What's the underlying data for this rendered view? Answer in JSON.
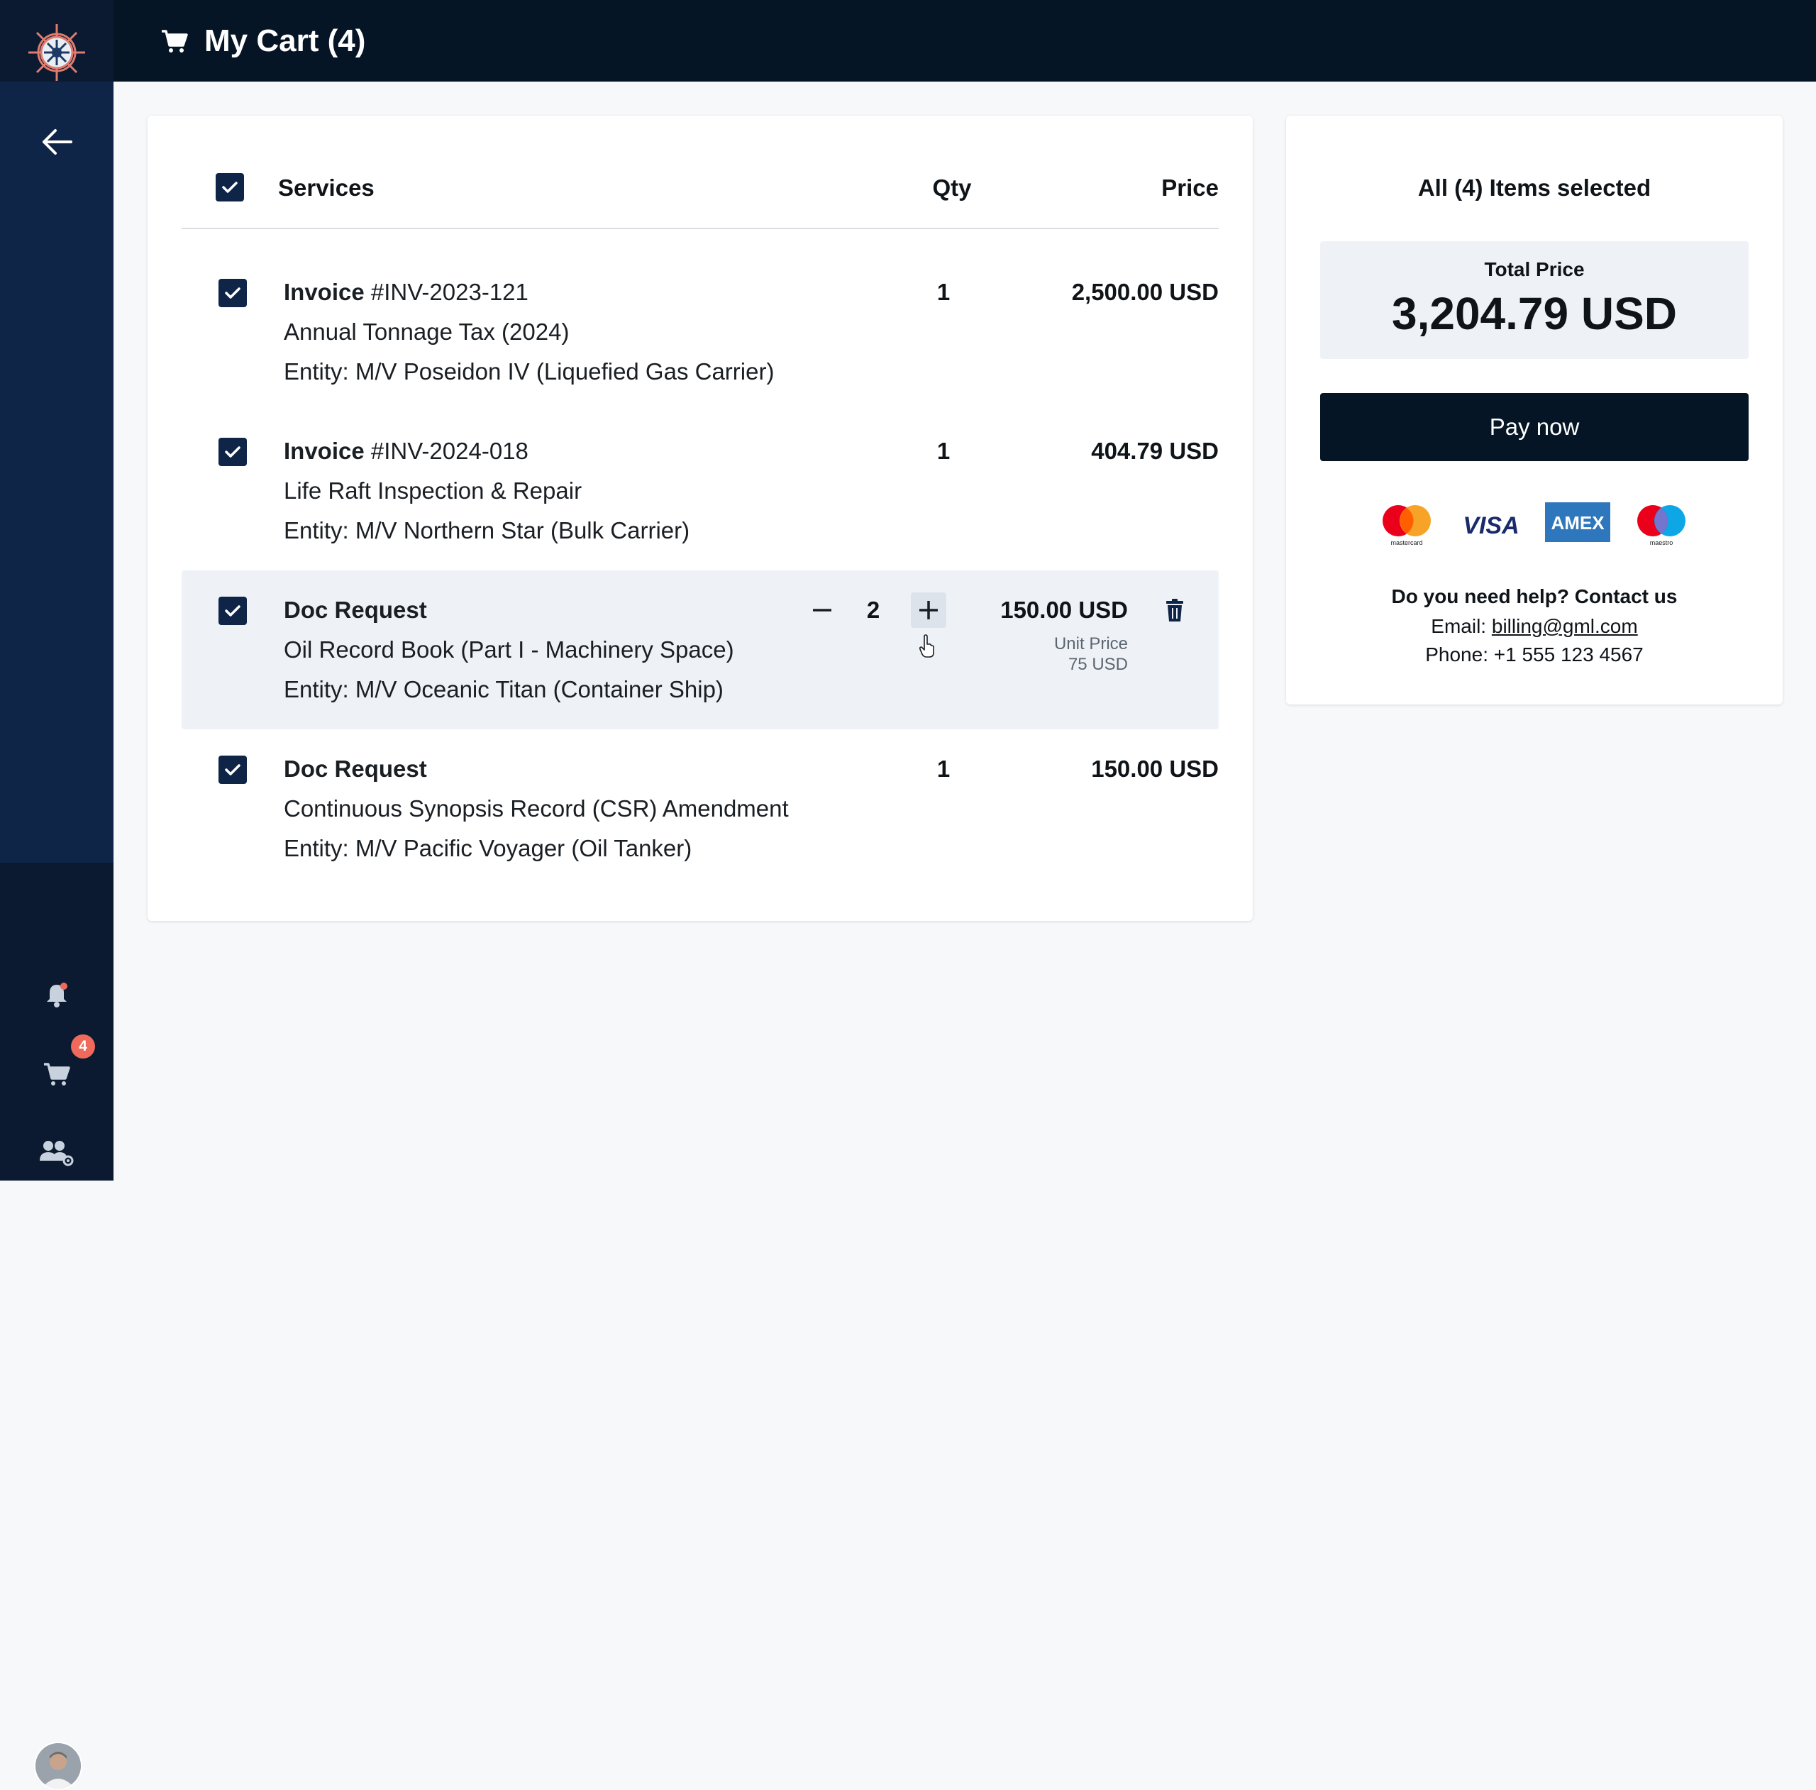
{
  "header": {
    "title": "My Cart (4)"
  },
  "sidebar": {
    "cart_badge": "4"
  },
  "cart": {
    "columns": {
      "services": "Services",
      "qty": "Qty",
      "price": "Price"
    },
    "items": [
      {
        "type": "Invoice",
        "ref": "#INV-2023-121",
        "description": "Annual Tonnage Tax (2024)",
        "entity": "Entity: M/V Poseidon IV (Liquefied Gas Carrier)",
        "qty": "1",
        "price": "2,500.00 USD",
        "selected": true
      },
      {
        "type": "Invoice",
        "ref": "#INV-2024-018",
        "description": "Life Raft Inspection & Repair",
        "entity": "Entity: M/V Northern Star (Bulk Carrier)",
        "qty": "1",
        "price": "404.79 USD",
        "selected": true
      },
      {
        "type": "Doc Request",
        "ref": "",
        "description": "Oil Record Book (Part I - Machinery Space)",
        "entity": "Entity: M/V Oceanic Titan (Container Ship)",
        "qty": "2",
        "price": "150.00 USD",
        "unit_price_label": "Unit Price",
        "unit_price": "75 USD",
        "selected": true,
        "editing": true
      },
      {
        "type": "Doc Request",
        "ref": "",
        "description": "Continuous Synopsis Record (CSR) Amendment",
        "entity": "Entity: M/V Pacific Voyager (Oil Tanker)",
        "qty": "1",
        "price": "150.00 USD",
        "selected": true
      }
    ]
  },
  "summary": {
    "title": "All (4) Items selected",
    "total_label": "Total Price",
    "total_value": "3,204.79 USD",
    "pay_label": "Pay now",
    "payment_methods": [
      "mastercard",
      "VISA",
      "AMEX",
      "maestro"
    ],
    "help_title": "Do you need help? Contact us",
    "email_label": "Email:",
    "email": "billing@gml.com",
    "phone": "Phone: +1 555 123 4567"
  },
  "icons": [
    "ship-wheel-logo-icon",
    "back-arrow-icon",
    "bell-icon",
    "cart-icon",
    "users-gear-icon",
    "checkbox-checked-icon",
    "minus-icon",
    "plus-icon",
    "trash-icon",
    "cursor-hand-icon"
  ],
  "colors": {
    "sidebar": "#0f2547",
    "header": "#061525",
    "accent_badge": "#ef6a5b",
    "highlight_row": "#eef2f7"
  }
}
